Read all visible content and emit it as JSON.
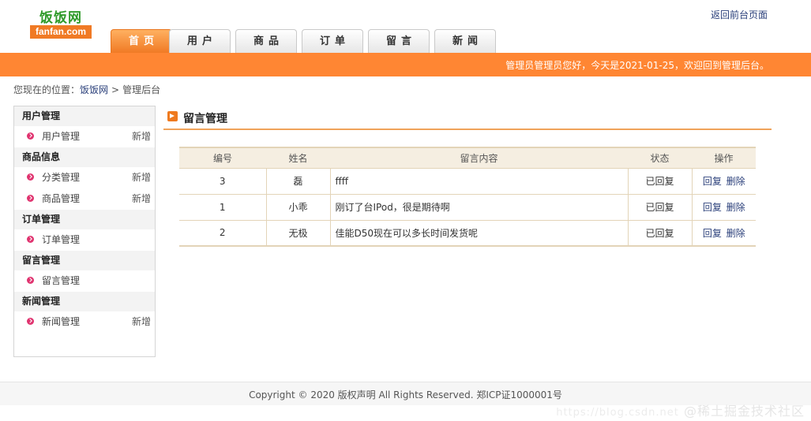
{
  "logo": {
    "cn": "饭饭网",
    "en": "fanfan.com"
  },
  "header": {
    "back_link": "返回前台页面"
  },
  "nav": [
    "首页",
    "用户",
    "商品",
    "订单",
    "留言",
    "新闻"
  ],
  "topbar": {
    "welcome": "管理员管理员您好，今天是2021-01-25，欢迎回到管理后台。"
  },
  "breadcrumb": {
    "prefix": "您现在的位置：",
    "site": "饭饭网",
    "sep": ">",
    "current": "管理后台"
  },
  "sidebar": {
    "groups": [
      {
        "title": "用户管理",
        "items": [
          {
            "label": "用户管理",
            "add": "新增"
          }
        ]
      },
      {
        "title": "商品信息",
        "items": [
          {
            "label": "分类管理",
            "add": "新增"
          },
          {
            "label": "商品管理",
            "add": "新增"
          }
        ]
      },
      {
        "title": "订单管理",
        "items": [
          {
            "label": "订单管理",
            "add": ""
          }
        ]
      },
      {
        "title": "留言管理",
        "items": [
          {
            "label": "留言管理",
            "add": ""
          }
        ]
      },
      {
        "title": "新闻管理",
        "items": [
          {
            "label": "新闻管理",
            "add": "新增"
          }
        ]
      }
    ]
  },
  "panel": {
    "title": "留言管理"
  },
  "table": {
    "headers": [
      "编号",
      "姓名",
      "留言内容",
      "状态",
      "操作"
    ],
    "rows": [
      {
        "id": "3",
        "name": "磊",
        "content": "ffff",
        "status": "已回复",
        "reply": "回复",
        "delete": "删除"
      },
      {
        "id": "1",
        "name": "小乖",
        "content": "刚订了台IPod，很是期待啊",
        "status": "已回复",
        "reply": "回复",
        "delete": "删除"
      },
      {
        "id": "2",
        "name": "无极",
        "content": "佳能D50现在可以多长时间发货呢",
        "status": "已回复",
        "reply": "回复",
        "delete": "删除"
      }
    ]
  },
  "footer": {
    "copyright": "Copyright © 2020 版权声明 All Rights Reserved. 郑ICP证1000001号"
  },
  "watermark": {
    "url": "https://blog.csdn.net",
    "text": "@稀土掘金技术社区"
  },
  "colors": {
    "accent": "#ff8633",
    "link": "#2a3f7a",
    "bullet": "#e0336f",
    "table_border": "#e3d4b8"
  }
}
